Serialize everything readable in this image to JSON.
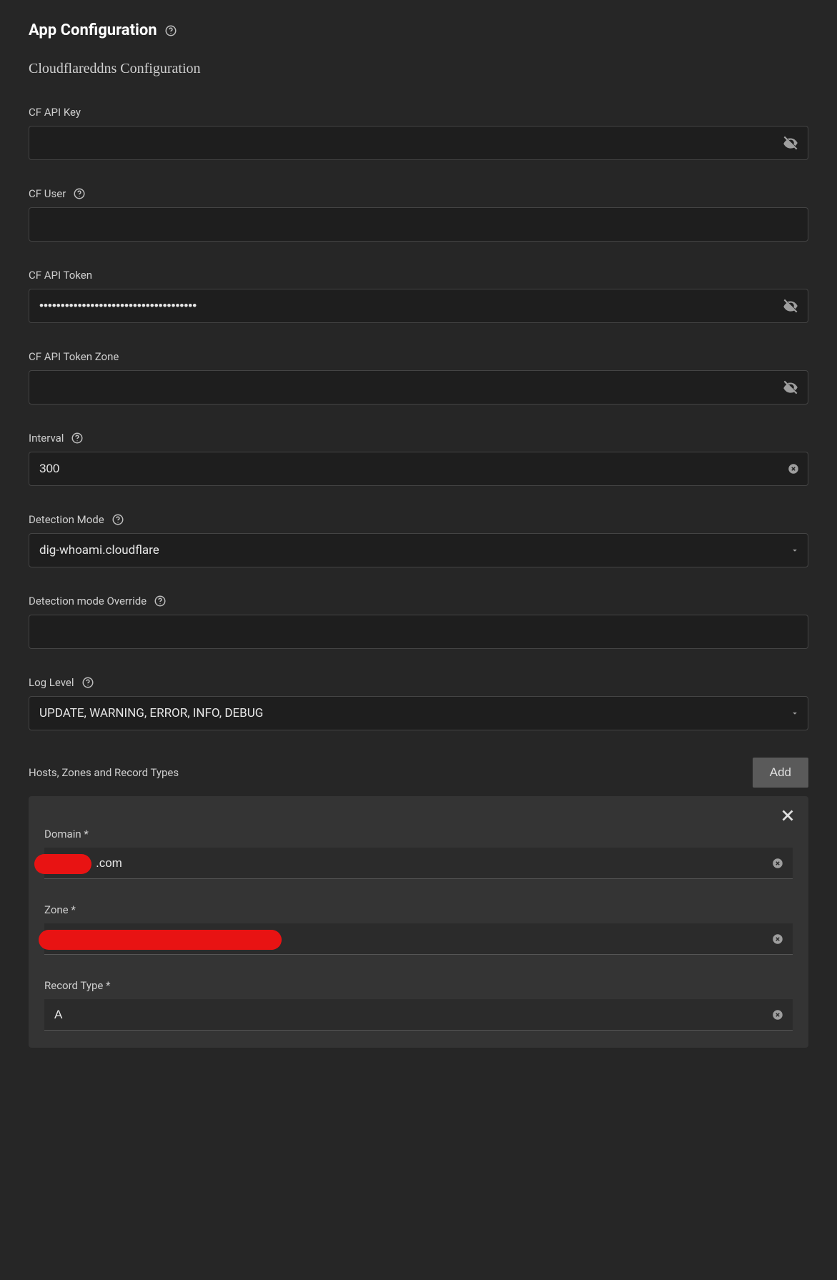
{
  "page_title": "App Configuration",
  "section_title": "Cloudflareddns Configuration",
  "fields": {
    "cf_api_key": {
      "label": "CF API Key",
      "value": ""
    },
    "cf_user": {
      "label": "CF User",
      "value": ""
    },
    "cf_api_token": {
      "label": "CF API Token",
      "value": "•••••••••••••••••••••••••••••••••••••"
    },
    "cf_api_token_zone": {
      "label": "CF API Token Zone",
      "value": ""
    },
    "interval": {
      "label": "Interval",
      "value": "300"
    },
    "detection_mode": {
      "label": "Detection Mode",
      "value": "dig-whoami.cloudflare"
    },
    "detection_mode_override": {
      "label": "Detection mode Override",
      "value": ""
    },
    "log_level": {
      "label": "Log Level",
      "value": "UPDATE, WARNING, ERROR, INFO, DEBUG"
    }
  },
  "records_section": {
    "label": "Hosts, Zones and Record Types",
    "add_button": "Add"
  },
  "record_item": {
    "domain": {
      "label": "Domain *",
      "value": ".com"
    },
    "zone": {
      "label": "Zone *",
      "value": ""
    },
    "record_type": {
      "label": "Record Type *",
      "value": "A"
    }
  }
}
